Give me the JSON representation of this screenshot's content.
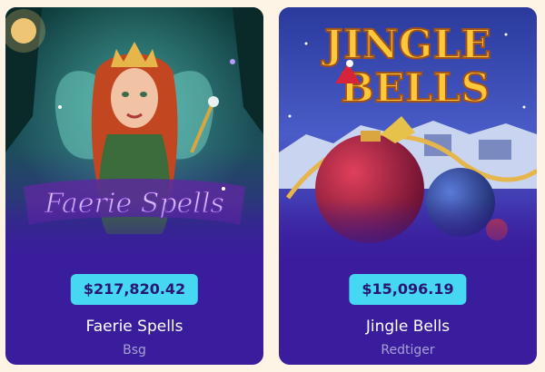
{
  "games": [
    {
      "title": "Faerie Spells",
      "provider": "Bsg",
      "jackpot": "$217,820.42",
      "logo_text": "Faerie Spells"
    },
    {
      "title": "Jingle Bells",
      "provider": "Redtiger",
      "jackpot": "$15,096.19",
      "logo_line1": "JINGLE",
      "logo_line2": "BELLS"
    }
  ],
  "colors": {
    "page_background": "#fdf4e6",
    "card_background": "#3a1d9c",
    "jackpot_badge": "#46d7f2",
    "jackpot_text": "#2a1672",
    "provider_text": "#a8a0d6"
  }
}
